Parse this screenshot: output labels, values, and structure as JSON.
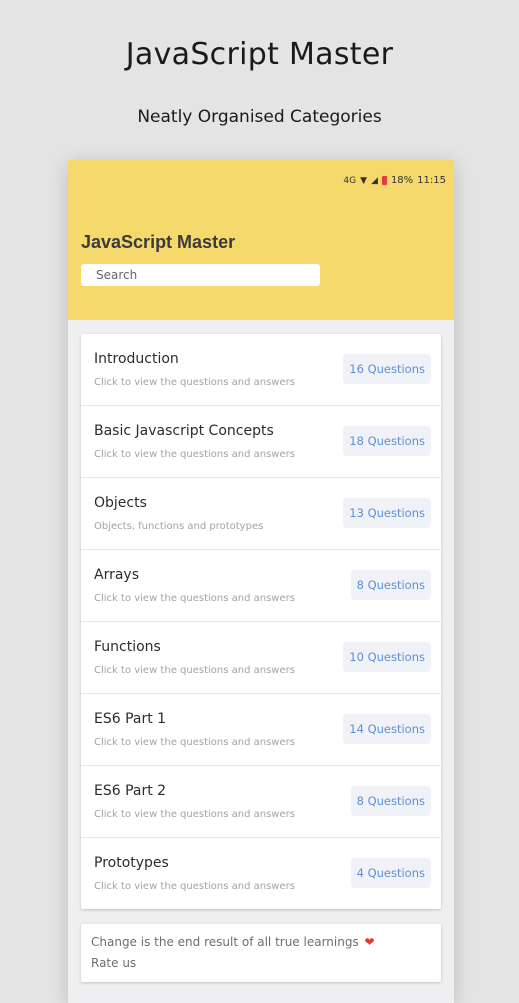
{
  "promo": {
    "title": "JavaScript Master",
    "subtitle": "Neatly Organised Categories"
  },
  "status_bar": {
    "net_label": "4G",
    "battery_text": "18%",
    "time": "11:15"
  },
  "header": {
    "title": "JavaScript Master"
  },
  "search": {
    "placeholder": "Search",
    "value": ""
  },
  "categories": [
    {
      "title": "Introduction",
      "description": "Click to view the questions and answers",
      "badge": "16 Questions"
    },
    {
      "title": "Basic Javascript Concepts",
      "description": "Click to view the questions and answers",
      "badge": "18 Questions"
    },
    {
      "title": "Objects",
      "description": "Objects, functions and prototypes",
      "badge": "13 Questions"
    },
    {
      "title": "Arrays",
      "description": "Click to view the questions and answers",
      "badge": "8 Questions"
    },
    {
      "title": "Functions",
      "description": "Click to view the questions and answers",
      "badge": "10 Questions"
    },
    {
      "title": "ES6 Part 1",
      "description": "Click to view the questions and answers",
      "badge": "14 Questions"
    },
    {
      "title": "ES6 Part 2",
      "description": "Click to view the questions and answers",
      "badge": "8 Questions"
    },
    {
      "title": "Prototypes",
      "description": "Click to view the questions and answers",
      "badge": "4 Questions"
    }
  ],
  "footer": {
    "quote": "Change is the end result of all true learnings",
    "heart_icon": "❤",
    "rate_label": "Rate us"
  },
  "colors": {
    "header_bg": "#f6d96c",
    "badge_text": "#5b8fd6",
    "heart": "#e53935"
  }
}
